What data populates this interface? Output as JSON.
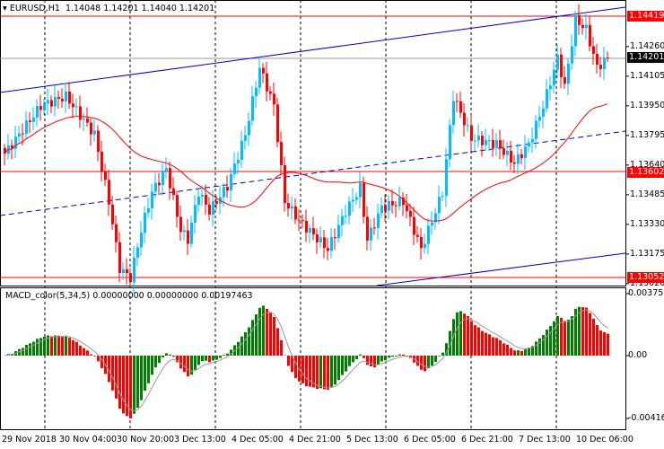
{
  "header": {
    "symbol": "EURUSD,H1",
    "open": "1.14048",
    "high": "1.14201",
    "low": "1.14040",
    "close": "1.14201"
  },
  "macd": {
    "title": "MACD_color(5,34,5)",
    "v1": "0.00000000",
    "v2": "0.00000000",
    "v3": "0.00197463",
    "ticks": [
      "0.003756",
      "0.00",
      "-0.004166"
    ],
    "range": [
      -0.004166,
      0.003756
    ]
  },
  "price_axis": {
    "ticks": [
      "1.14260",
      "1.14105",
      "1.13950",
      "1.13795",
      "1.13640",
      "1.13485",
      "1.13330",
      "1.13175",
      "1.13020"
    ],
    "range": [
      1.1302,
      1.14419
    ]
  },
  "tags": [
    {
      "text": "1.14419",
      "color": "#ff0000"
    },
    {
      "text": "1.14201",
      "color": "#000000"
    },
    {
      "text": "1.13602",
      "color": "#ff0000"
    },
    {
      "text": "1.13052",
      "color": "#ff0000"
    }
  ],
  "time_axis": [
    "29 Nov 2018",
    "30 Nov 04:00",
    "30 Nov 20:00",
    "3 Dec 13:00",
    "4 Dec 05:00",
    "4 Dec 21:00",
    "5 Dec 13:00",
    "6 Dec 05:00",
    "6 Dec 21:00",
    "7 Dec 13:00",
    "10 Dec 06:00"
  ],
  "colors": {
    "bull": "#00bfff",
    "bear": "#ff0000",
    "macd_up": "#008000",
    "macd_down": "#ff0000",
    "channel": "#0000cc"
  },
  "price_anchors": [
    [
      0,
      1.137
    ],
    [
      10,
      1.1395
    ],
    [
      17,
      1.14
    ],
    [
      25,
      1.138
    ],
    [
      29,
      1.1345
    ],
    [
      32,
      1.131
    ],
    [
      35,
      1.1305
    ],
    [
      38,
      1.133
    ],
    [
      41,
      1.135
    ],
    [
      45,
      1.1362
    ],
    [
      49,
      1.133
    ],
    [
      51,
      1.1325
    ],
    [
      54,
      1.135
    ],
    [
      57,
      1.134
    ],
    [
      62,
      1.1353
    ],
    [
      67,
      1.138
    ],
    [
      71,
      1.1415
    ],
    [
      75,
      1.1395
    ],
    [
      78,
      1.1345
    ],
    [
      82,
      1.1335
    ],
    [
      90,
      1.132
    ],
    [
      95,
      1.134
    ],
    [
      99,
      1.1352
    ],
    [
      101,
      1.1325
    ],
    [
      105,
      1.1342
    ],
    [
      111,
      1.1345
    ],
    [
      116,
      1.132
    ],
    [
      122,
      1.135
    ],
    [
      125,
      1.14
    ],
    [
      130,
      1.1378
    ],
    [
      137,
      1.1375
    ],
    [
      142,
      1.1365
    ],
    [
      146,
      1.1375
    ],
    [
      150,
      1.1395
    ],
    [
      154,
      1.142
    ],
    [
      156,
      1.1405
    ],
    [
      159,
      1.144
    ],
    [
      162,
      1.1435
    ],
    [
      165,
      1.1415
    ],
    [
      168,
      1.14201
    ]
  ]
}
